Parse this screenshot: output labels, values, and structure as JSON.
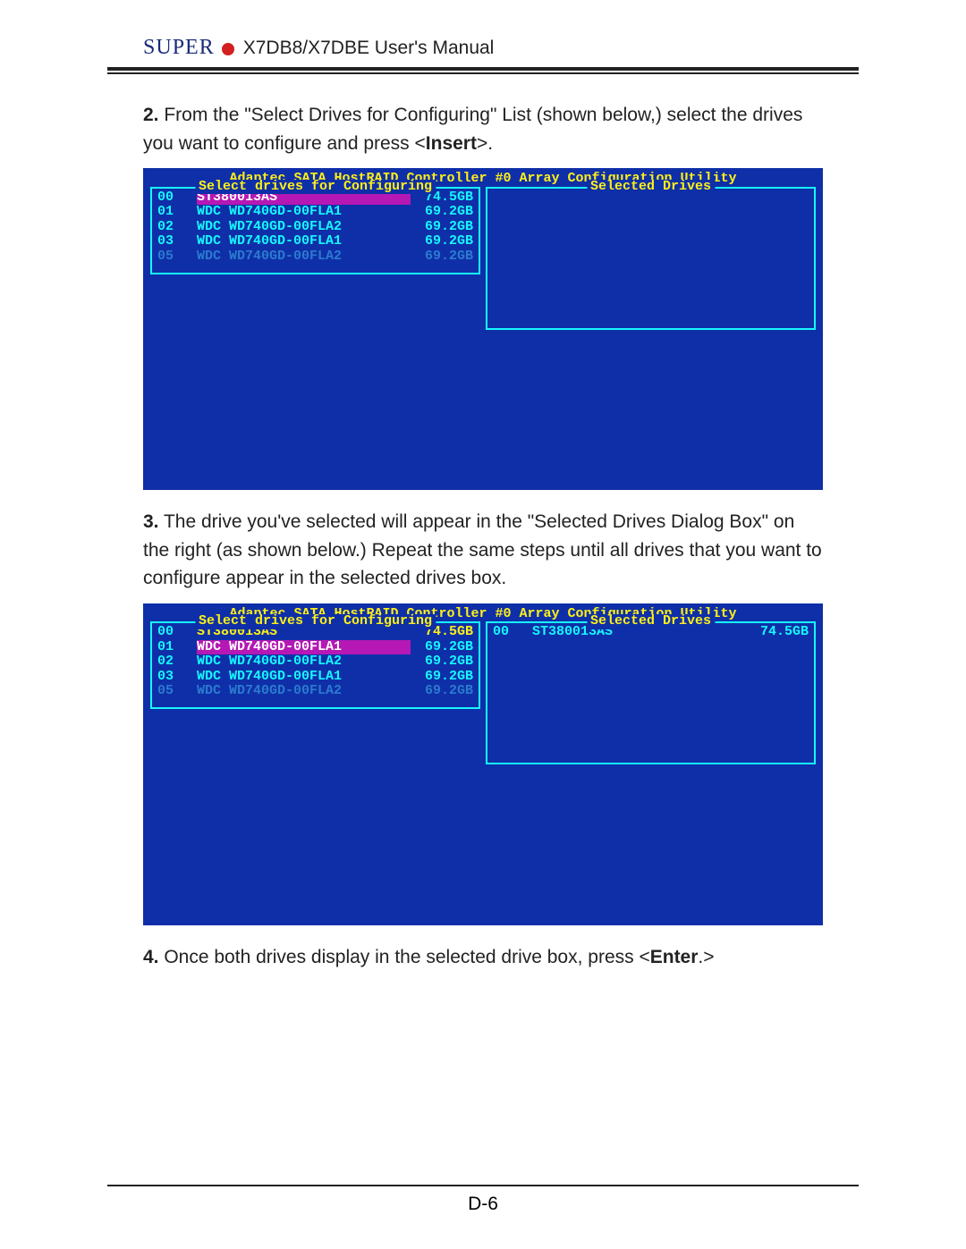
{
  "header": {
    "logo": "SUPER",
    "title": "X7DB8/X7DBE User's Manual"
  },
  "step2": {
    "num": "2.",
    "text_a": " From the \"Select Drives for Configuring\" List (shown below,) select the drives you want to configure and press <",
    "bold": "Insert",
    "text_b": ">."
  },
  "bios1": {
    "title": "Adaptec SATA HostRAID Controller #0 Array Configuration Utility",
    "left_title": "Select drives for Configuring",
    "right_title": "Selected Drives",
    "drives": [
      {
        "idx": "00",
        "model": "ST380013AS",
        "size": "74.5GB",
        "selected": true
      },
      {
        "idx": "01",
        "model": "WDC WD740GD-00FLA1",
        "size": "69.2GB"
      },
      {
        "idx": "02",
        "model": "WDC WD740GD-00FLA2",
        "size": "69.2GB"
      },
      {
        "idx": "03",
        "model": "WDC WD740GD-00FLA1",
        "size": "69.2GB"
      },
      {
        "idx": "05",
        "model": "WDC WD740GD-00FLA2",
        "size": "69.2GB",
        "dim": true
      }
    ]
  },
  "step3": {
    "num": "3.",
    "text": " The drive you've selected will appear in the \"Selected Drives Dialog Box\" on the right (as shown below.) Repeat the same steps until all drives that you want to configure appear in the selected drives box."
  },
  "bios2": {
    "title": "Adaptec SATA HostRAID Controller #0 Array Configuration Utility",
    "left_title": "Select drives for Configuring",
    "right_title": "Selected Drives",
    "drives": [
      {
        "idx": "00",
        "model": "ST380013AS",
        "size": "74.5GB",
        "yellow": true
      },
      {
        "idx": "01",
        "model": "WDC WD740GD-00FLA1",
        "size": "69.2GB",
        "selected": true
      },
      {
        "idx": "02",
        "model": "WDC WD740GD-00FLA2",
        "size": "69.2GB"
      },
      {
        "idx": "03",
        "model": "WDC WD740GD-00FLA1",
        "size": "69.2GB"
      },
      {
        "idx": "05",
        "model": "WDC WD740GD-00FLA2",
        "size": "69.2GB",
        "dim": true
      }
    ],
    "selected": [
      {
        "idx": "00",
        "model": "ST380013AS",
        "size": "74.5GB"
      }
    ]
  },
  "step4": {
    "num": "4.",
    "text_a": " Once both drives display in the selected drive box, press <",
    "bold": "Enter",
    "text_b": ".>"
  },
  "page_number": "D-6"
}
